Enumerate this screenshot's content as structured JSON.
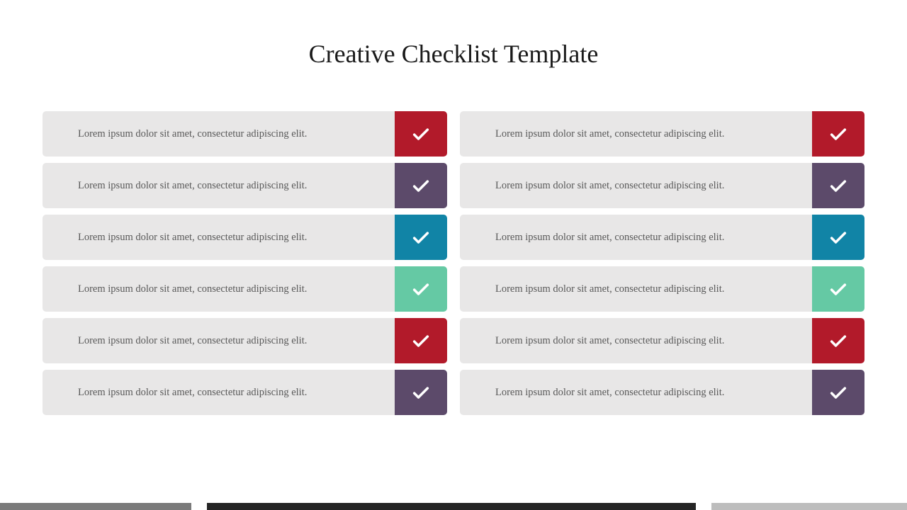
{
  "title": "Creative Checklist Template",
  "colors": {
    "red": "#b21a2a",
    "purple": "#5c4a6a",
    "teal": "#1184a6",
    "mint": "#65c9a4"
  },
  "leftItems": [
    {
      "text": "Lorem ipsum dolor sit amet, consectetur adipiscing elit.",
      "color": "red"
    },
    {
      "text": "Lorem ipsum dolor sit amet, consectetur adipiscing elit.",
      "color": "purple"
    },
    {
      "text": "Lorem ipsum dolor sit amet, consectetur adipiscing elit.",
      "color": "teal"
    },
    {
      "text": "Lorem ipsum dolor sit amet, consectetur adipiscing elit.",
      "color": "mint"
    },
    {
      "text": "Lorem ipsum dolor sit amet, consectetur adipiscing elit.",
      "color": "red"
    },
    {
      "text": "Lorem ipsum dolor sit amet, consectetur adipiscing elit.",
      "color": "purple"
    }
  ],
  "rightItems": [
    {
      "text": "Lorem ipsum dolor sit amet, consectetur adipiscing elit.",
      "color": "red"
    },
    {
      "text": "Lorem ipsum dolor sit amet, consectetur adipiscing elit.",
      "color": "purple"
    },
    {
      "text": "Lorem ipsum dolor sit amet, consectetur adipiscing elit.",
      "color": "teal"
    },
    {
      "text": "Lorem ipsum dolor sit amet, consectetur adipiscing elit.",
      "color": "mint"
    },
    {
      "text": "Lorem ipsum dolor sit amet, consectetur adipiscing elit.",
      "color": "red"
    },
    {
      "text": "Lorem ipsum dolor sit amet, consectetur adipiscing elit.",
      "color": "purple"
    }
  ]
}
